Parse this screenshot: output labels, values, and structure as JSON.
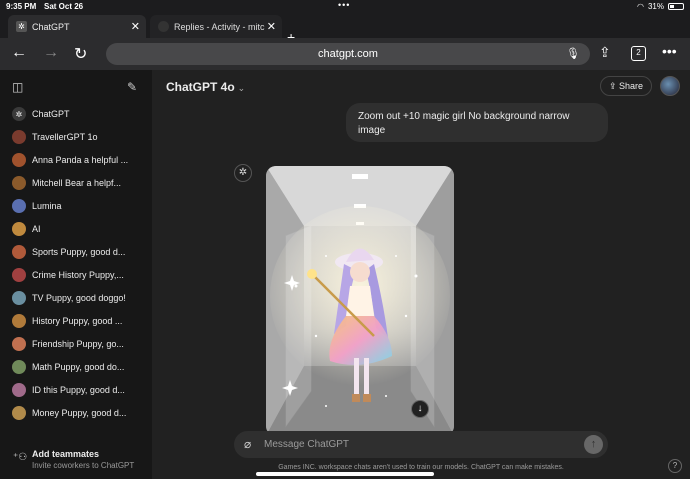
{
  "status_bar": {
    "time": "9:35 PM",
    "date": "Sat Oct 26",
    "battery": "31%"
  },
  "tabs": [
    {
      "label": "ChatGPT",
      "active": true
    },
    {
      "label": "Replies - Activity - mitc",
      "active": false
    }
  ],
  "toolbar": {
    "url": "chatgpt.com",
    "tab_count": "2"
  },
  "sidebar": {
    "items": [
      {
        "label": "ChatGPT",
        "color": "#3a3a3a"
      },
      {
        "label": "TravellerGPT 1o",
        "color": "#7a3b2e"
      },
      {
        "label": "Anna Panda a helpful ...",
        "color": "#a0522d"
      },
      {
        "label": "Mitchell Bear a helpf...",
        "color": "#8b5a2b"
      },
      {
        "label": "Lumina",
        "color": "#5a6fb0"
      },
      {
        "label": "AI",
        "color": "#c08a3e"
      },
      {
        "label": "Sports Puppy, good d...",
        "color": "#b05a3a"
      },
      {
        "label": "Crime History Puppy,...",
        "color": "#a04040"
      },
      {
        "label": "TV Puppy, good doggo!",
        "color": "#6a8fa0"
      },
      {
        "label": "History Puppy, good ...",
        "color": "#b07a3a"
      },
      {
        "label": "Friendship Puppy, go...",
        "color": "#c07050"
      },
      {
        "label": "Math Puppy, good do...",
        "color": "#708a5a"
      },
      {
        "label": "ID this Puppy, good d...",
        "color": "#a06a8a"
      },
      {
        "label": "Money Puppy, good d...",
        "color": "#b08a4a"
      }
    ],
    "footer_title": "Add teammates",
    "footer_subtitle": "Invite coworkers to ChatGPT"
  },
  "main": {
    "model": "ChatGPT 4o",
    "share_label": "Share",
    "user_message": "Zoom out +10 magic girl No background narrow image",
    "composer_placeholder": "Message ChatGPT",
    "disclaimer": "Games INC. workspace chats aren't used to train our models. ChatGPT can make mistakes."
  }
}
